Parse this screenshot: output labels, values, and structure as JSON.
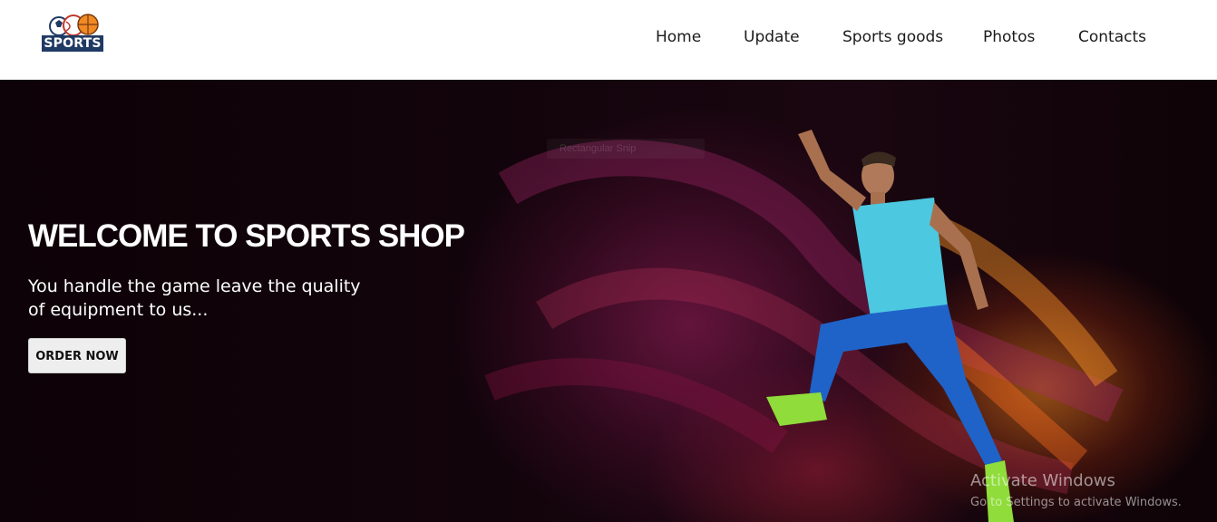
{
  "logo": {
    "text": "SPORTS"
  },
  "nav": {
    "items": [
      {
        "label": "Home"
      },
      {
        "label": "Update"
      },
      {
        "label": "Sports goods"
      },
      {
        "label": "Photos"
      },
      {
        "label": "Contacts"
      }
    ]
  },
  "hero": {
    "title": "WELCOME TO SPORTS SHOP",
    "subtitle": "You handle the game leave the quality of equipment to us...",
    "cta_label": "ORDER NOW",
    "image": "sprinter-light-trails-photo",
    "ghost_label": "Rectangular Snip"
  },
  "watermark": {
    "title": "Activate Windows",
    "subtitle": "Go to Settings to activate Windows."
  },
  "colors": {
    "header_bg": "#ffffff",
    "hero_bg": "#12040b",
    "logo_plate": "#1f3a63",
    "button_bg": "#eeeeee",
    "shirt": "#4cc8e0",
    "tights": "#1f63c8",
    "shoes": "#8fdc3a"
  }
}
